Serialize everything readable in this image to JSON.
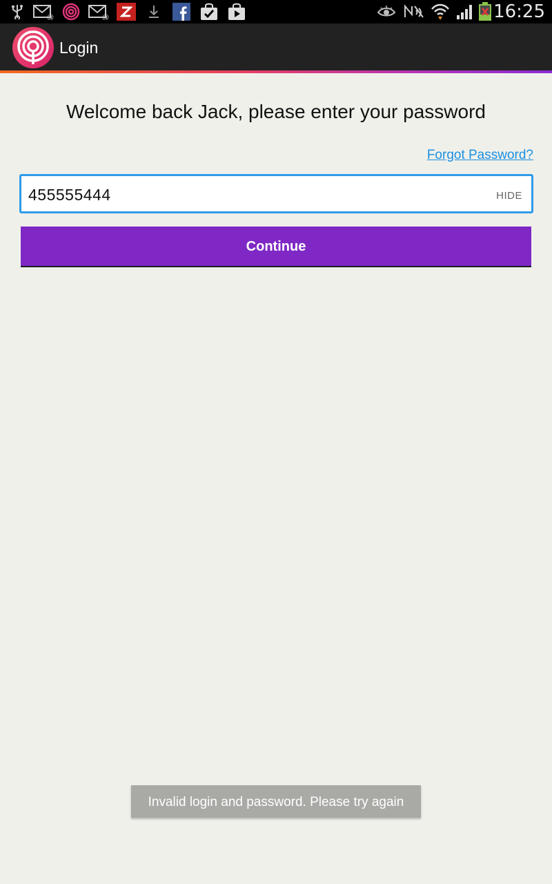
{
  "status_bar": {
    "time": "16:25",
    "left_icons": [
      "usb-icon",
      "email-icon",
      "life360-icon",
      "email-icon",
      "zedge-icon",
      "download-icon",
      "facebook-icon",
      "shopping-bag-icon",
      "play-store-icon"
    ],
    "right_icons": [
      "smart-stay-eye-icon",
      "no-signal-nfc-icon",
      "wifi-icon",
      "cell-signal-icon",
      "battery-charging-icon"
    ]
  },
  "action_bar": {
    "title": "Login",
    "logo_icon": "life360-logo-icon"
  },
  "main": {
    "welcome_text": "Welcome back Jack, please enter your password",
    "forgot_password_link": "Forgot Password?",
    "password_value": "455555444",
    "hide_toggle_label": "HIDE",
    "continue_label": "Continue"
  },
  "toast": {
    "message": "Invalid login and password. Please try again"
  },
  "colors": {
    "accent_purple": "#7f28c6",
    "field_border": "#2f9be8",
    "link_blue": "#1a8fe0",
    "action_bar": "#222222",
    "background": "#f0f0eb"
  }
}
